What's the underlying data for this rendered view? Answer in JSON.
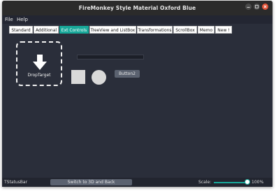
{
  "window": {
    "title": "FireMonkey Style Material Oxford Blue"
  },
  "menu": {
    "items": [
      {
        "label": "File"
      },
      {
        "label": "Help"
      }
    ]
  },
  "tabs": [
    {
      "label": "Standard"
    },
    {
      "label": "Additional"
    },
    {
      "label": "Ext Controls"
    },
    {
      "label": "TreeView and ListBox"
    },
    {
      "label": "Transformations"
    },
    {
      "label": "ScrollBox"
    },
    {
      "label": "Memo"
    },
    {
      "label": "New !"
    }
  ],
  "active_tab": "Ext Controls",
  "content": {
    "drop_target_label": "DropTarget",
    "button2_label": "Button2",
    "progress_fraction": 0.0
  },
  "statusbar": {
    "label": "TStatusBar",
    "switch_button_label": "Switch to 3D and Back",
    "scale_label": "Scale:",
    "scale_value": "100%"
  },
  "colors": {
    "accent": "#18a89a",
    "background": "#2a2e3a",
    "close_button": "#e2553a"
  }
}
